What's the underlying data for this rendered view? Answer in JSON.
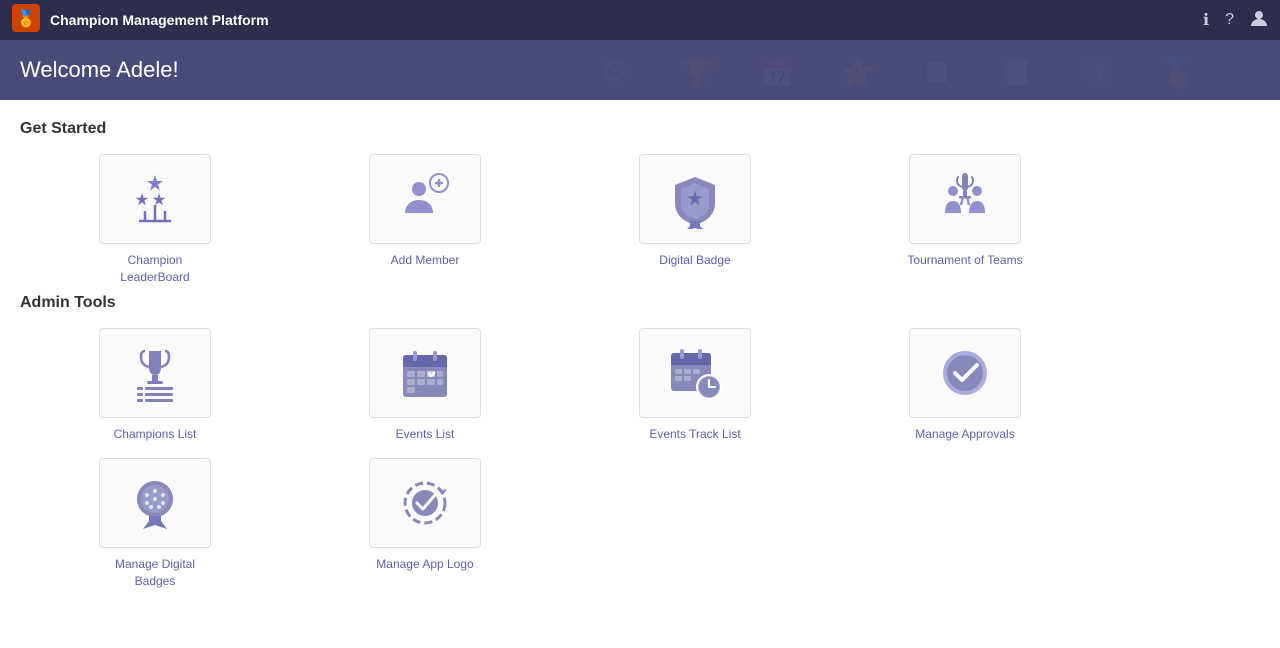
{
  "app": {
    "title": "Champion Management Platform",
    "logo_text": "🏆"
  },
  "topbar": {
    "icons": [
      "info",
      "help",
      "person"
    ]
  },
  "banner": {
    "welcome_text": "Welcome Adele!"
  },
  "get_started": {
    "section_title": "Get Started",
    "items": [
      {
        "id": "champion-leaderboard",
        "label": "Champion\nLeaderBoard",
        "icon": "trophy-stars"
      },
      {
        "id": "add-member",
        "label": "Add Member",
        "icon": "add-people"
      },
      {
        "id": "digital-badge",
        "label": "Digital Badge",
        "icon": "shield-badge"
      },
      {
        "id": "tournament-of-teams",
        "label": "Tournament of Teams",
        "icon": "team-trophy"
      }
    ]
  },
  "admin_tools": {
    "section_title": "Admin Tools",
    "items": [
      {
        "id": "champions-list",
        "label": "Champions List",
        "icon": "trophy-list"
      },
      {
        "id": "events-list",
        "label": "Events List",
        "icon": "calendar-check"
      },
      {
        "id": "events-track-list",
        "label": "Events Track List",
        "icon": "calendar-clock"
      },
      {
        "id": "manage-approvals",
        "label": "Manage Approvals",
        "icon": "approve-badge"
      },
      {
        "id": "manage-digital-badges",
        "label": "Manage Digital\nBadges",
        "icon": "medal-dots"
      },
      {
        "id": "manage-app-logo",
        "label": "Manage App Logo",
        "icon": "logo-check"
      }
    ]
  }
}
